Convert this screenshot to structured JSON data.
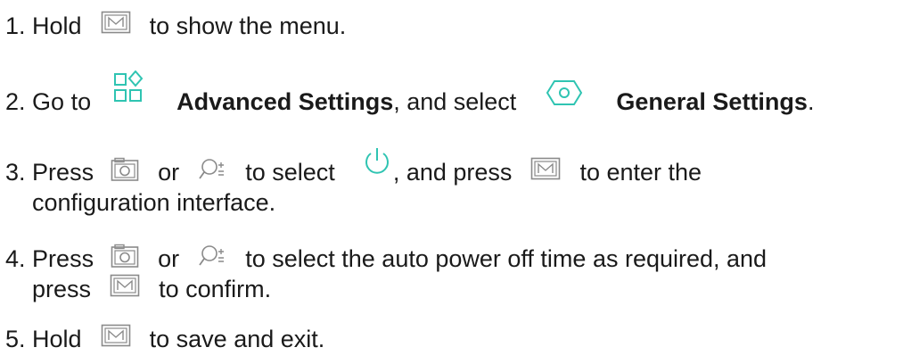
{
  "steps": [
    {
      "num": "1.",
      "t1": "Hold",
      "t2": "to show the menu."
    },
    {
      "num": "2.",
      "t1": "Go to",
      "adv": "Advanced Settings",
      "t2": ", and select",
      "gen": "General Settings",
      "t3": "."
    },
    {
      "num": "3.",
      "t1": "Press",
      "or": "or",
      "t2": "to select",
      "t3": ", and press",
      "t4": "to enter the",
      "t5": "configuration interface."
    },
    {
      "num": "4.",
      "t1": "Press",
      "or": "or",
      "t2": "to select the auto power off time as required, and",
      "t3": "press",
      "t4": "to confirm."
    },
    {
      "num": "5.",
      "t1": "Hold",
      "t2": "to save and exit."
    }
  ],
  "icons": {
    "menu_key": "menu-m-key-icon",
    "advanced": "advanced-settings-icon",
    "general": "general-settings-hexagon-icon",
    "camera": "camera-key-icon",
    "zoom": "zoom-key-icon",
    "power": "power-icon"
  },
  "colors": {
    "accent": "#2fc4b2",
    "text": "#1a1a1a",
    "key_gray": "#8a8a8a"
  }
}
